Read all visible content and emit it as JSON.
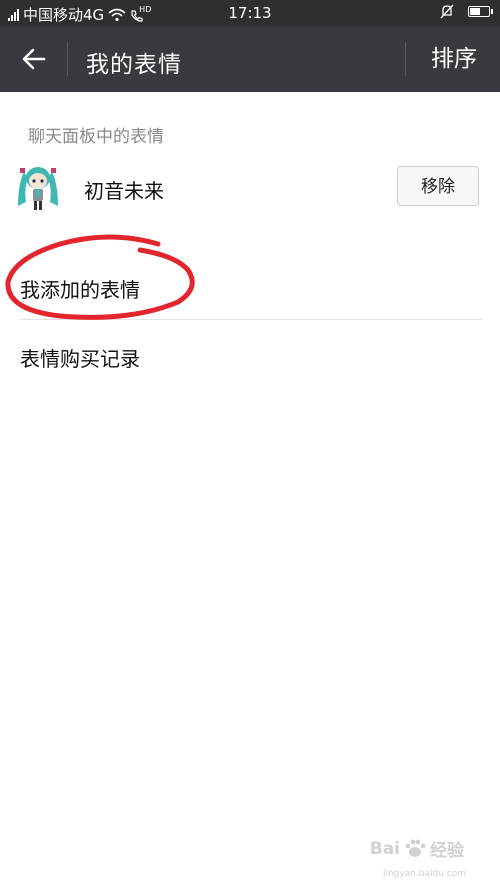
{
  "status_bar": {
    "carrier": "中国移动4G",
    "hd_label": "HD",
    "time": "17:13",
    "icons": [
      "signal-icon",
      "wifi-icon",
      "call-hd-icon",
      "mute-bell-icon",
      "battery-icon"
    ],
    "battery_level": 0.6
  },
  "header": {
    "title": "我的表情",
    "back_icon": "back-arrow-icon",
    "sort_label": "排序",
    "background": "#393a3f"
  },
  "chat_panel": {
    "section_label": "聊天面板中的表情",
    "items": [
      {
        "name": "初音未来",
        "remove_label": "移除"
      }
    ]
  },
  "menu": {
    "added_label": "我添加的表情",
    "purchases_label": "表情购买记录"
  },
  "annotation": {
    "color": "#e3262e",
    "shape": "hand-drawn-circle"
  },
  "watermark": {
    "brand": "Bai",
    "brand_suffix": "经验",
    "url": "jingyan.baidu.com"
  }
}
